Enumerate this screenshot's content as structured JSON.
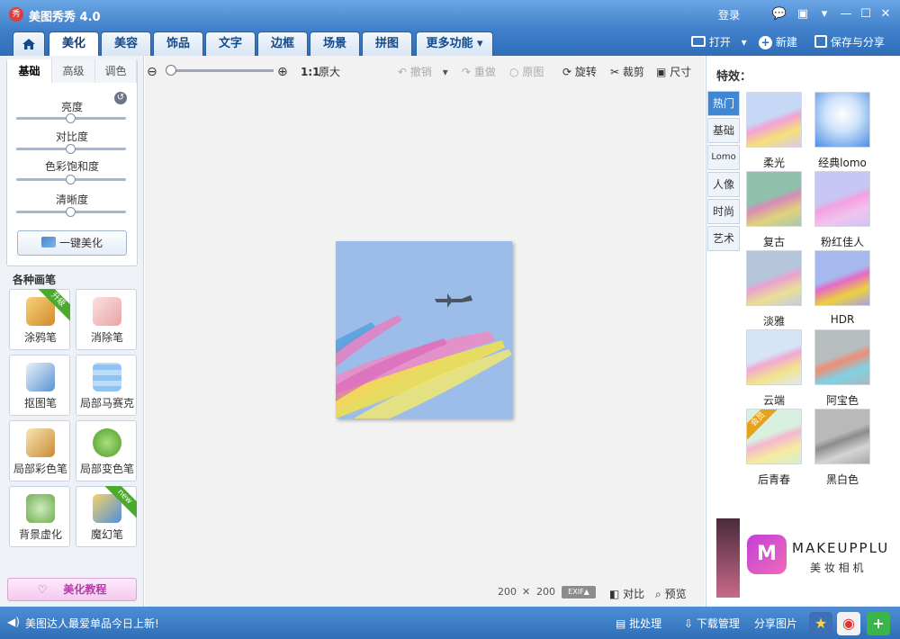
{
  "app": {
    "title": "美图秀秀 4.0",
    "logo_char": "秀",
    "login": "登录"
  },
  "window_controls": {
    "chat": "💬",
    "skin": "▣",
    "menu": "▾",
    "minimize": "—",
    "maximize": "☐",
    "close": "✕"
  },
  "tabs": [
    "美化",
    "美容",
    "饰品",
    "文字",
    "边框",
    "场景",
    "拼图",
    "更多功能 ▾"
  ],
  "top_right": {
    "open": "打开",
    "new": "新建",
    "save": "保存与分享"
  },
  "left": {
    "subtabs": [
      "基础",
      "高级",
      "调色"
    ],
    "sliders": [
      {
        "label": "亮度",
        "value": 0.5
      },
      {
        "label": "对比度",
        "value": 0.5
      },
      {
        "label": "色彩饱和度",
        "value": 0.5
      },
      {
        "label": "清晰度",
        "value": 0.5
      }
    ],
    "auto_button": "一键美化",
    "brush_title": "各种画笔",
    "brushes": [
      {
        "label": "涂鸦笔",
        "badge": "升级"
      },
      {
        "label": "消除笔",
        "badge": ""
      },
      {
        "label": "抠图笔",
        "badge": ""
      },
      {
        "label": "局部马赛克",
        "badge": ""
      },
      {
        "label": "局部彩色笔",
        "badge": ""
      },
      {
        "label": "局部变色笔",
        "badge": ""
      },
      {
        "label": "背景虚化",
        "badge": ""
      },
      {
        "label": "魔幻笔",
        "badge": "new"
      }
    ],
    "tutorial": "美化教程"
  },
  "toolbar": {
    "ratio": "1:1",
    "original_size": "原大",
    "undo": "撤销",
    "redo": "重做",
    "original": "原图",
    "rotate": "旋转",
    "crop": "裁剪",
    "resize": "尺寸",
    "zoom_level": 0.0
  },
  "canvas": {
    "width": "200",
    "times": "✕",
    "height": "200",
    "exif": "EXIF▲",
    "compare": "对比",
    "preview": "预览"
  },
  "right": {
    "title": "特效：",
    "categories": [
      "热门",
      "基础",
      "Lomo",
      "人像",
      "时尚",
      "艺术"
    ],
    "effects": [
      "柔光",
      "经典lomo",
      "复古",
      "粉红佳人",
      "淡雅",
      "HDR",
      "云端",
      "阿宝色",
      "后青春",
      "黑白色"
    ],
    "effect_badge": "会员",
    "ad": {
      "brand": "MAKEUPPLU",
      "sub": "美 妆 相 机"
    }
  },
  "status": {
    "message": "美图达人最爱单品今日上新!",
    "batch": "批处理",
    "download": "下载管理",
    "share": "分享图片"
  },
  "colors": {
    "brand_blue": "#3f7fc9",
    "accent_pink": "#b03da6",
    "green": "#4aaa2a"
  }
}
